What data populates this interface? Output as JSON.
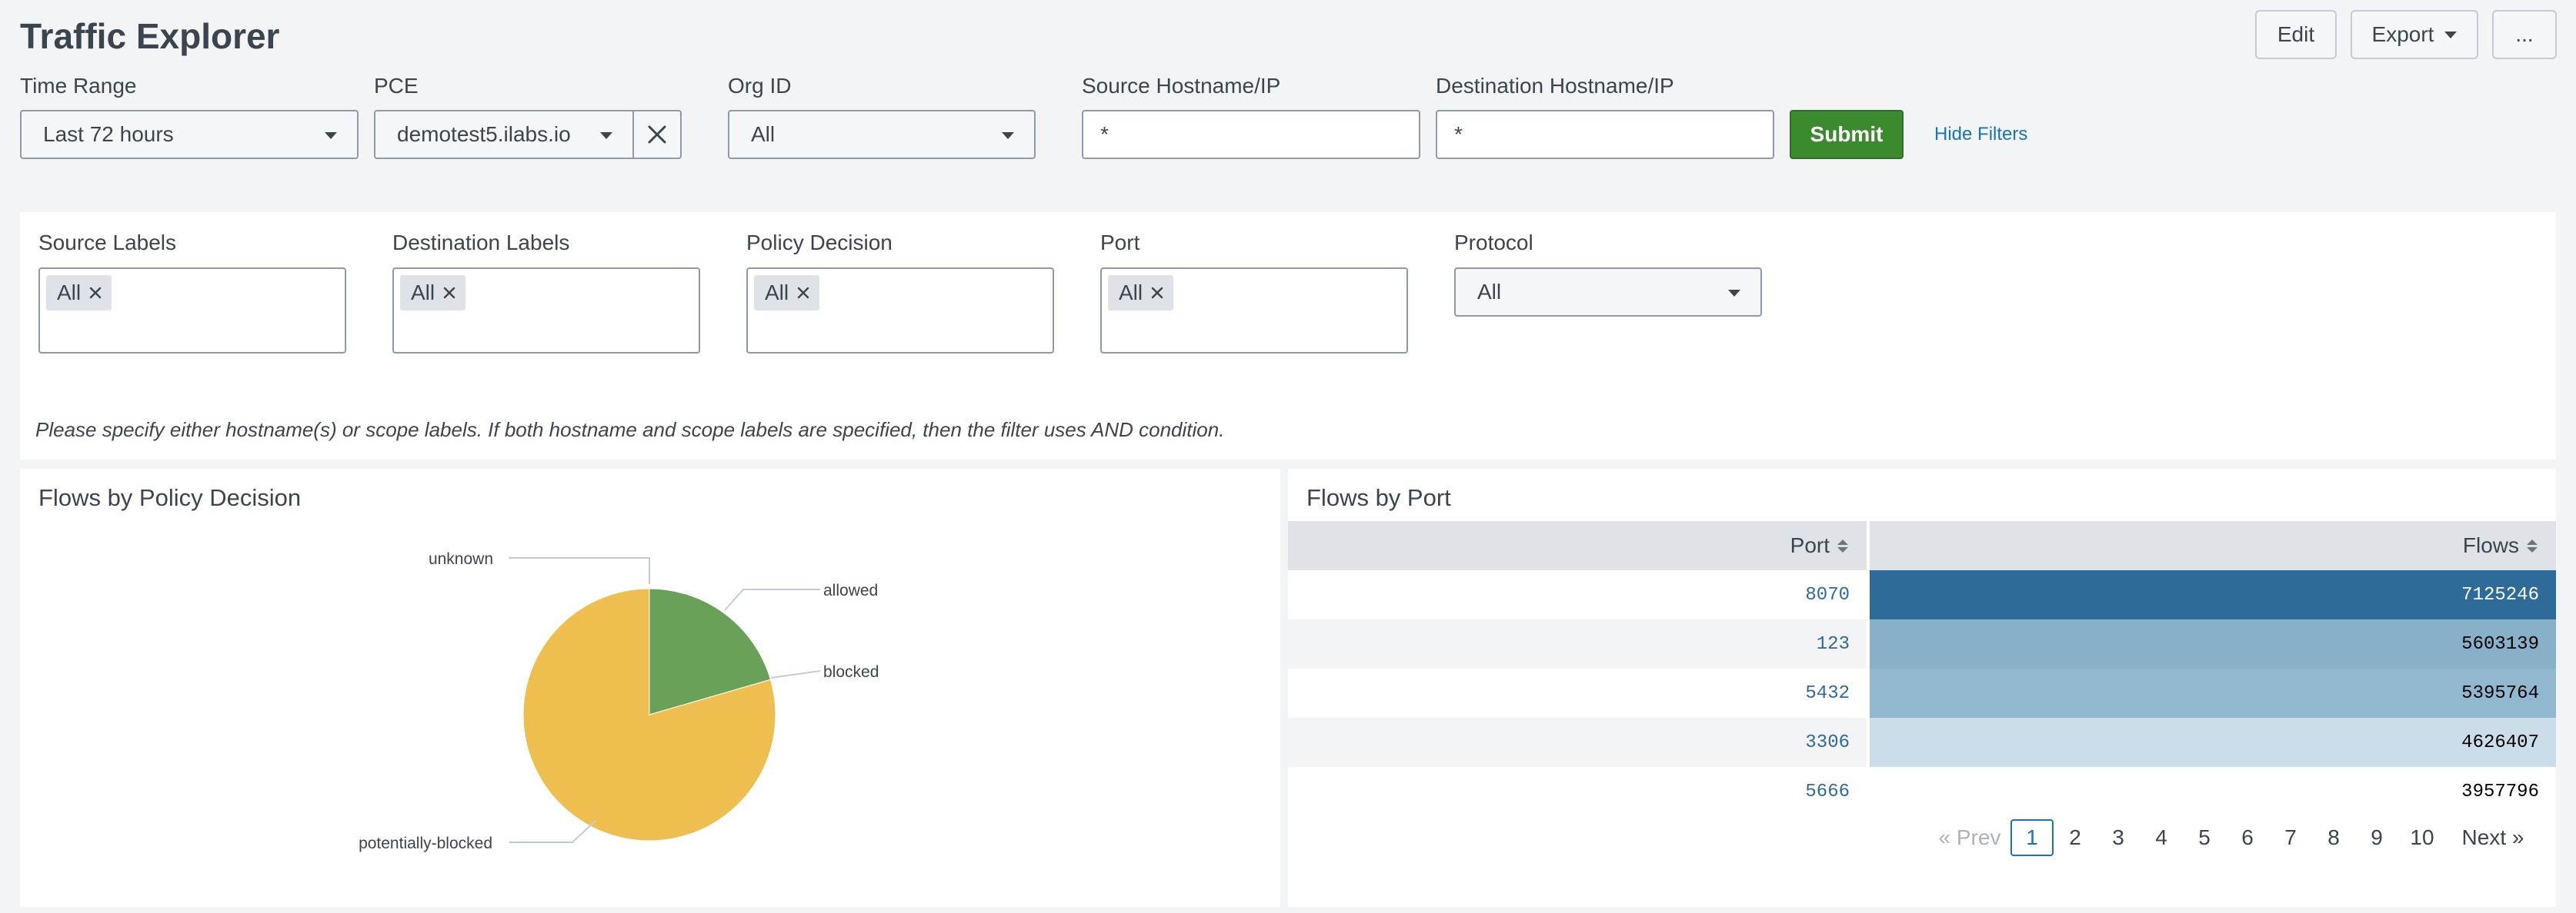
{
  "header": {
    "title": "Traffic Explorer",
    "edit_label": "Edit",
    "export_label": "Export",
    "more_label": "..."
  },
  "filters": {
    "time_range": {
      "label": "Time Range",
      "value": "Last 72 hours"
    },
    "pce": {
      "label": "PCE",
      "value": "demotest5.ilabs.io"
    },
    "org_id": {
      "label": "Org ID",
      "value": "All"
    },
    "source_host": {
      "label": "Source Hostname/IP",
      "value": "*"
    },
    "dest_host": {
      "label": "Destination Hostname/IP",
      "value": "*"
    },
    "submit_label": "Submit",
    "hide_filters_label": "Hide Filters"
  },
  "label_filters": {
    "source_labels": {
      "label": "Source Labels",
      "chip": "All"
    },
    "dest_labels": {
      "label": "Destination Labels",
      "chip": "All"
    },
    "policy_decision": {
      "label": "Policy Decision",
      "chip": "All"
    },
    "port": {
      "label": "Port",
      "chip": "All"
    },
    "protocol": {
      "label": "Protocol",
      "value": "All"
    },
    "note": "Please specify either hostname(s) or scope labels. If both hostname and scope labels are specified, then the filter uses AND condition."
  },
  "policy_panel": {
    "title": "Flows by Policy Decision",
    "chart_data": {
      "type": "pie",
      "slices": [
        {
          "label": "unknown",
          "fraction": 0.0,
          "color": "#6aa159"
        },
        {
          "label": "allowed",
          "fraction": 0.205,
          "color": "#6aa159"
        },
        {
          "label": "blocked",
          "fraction": 0.0,
          "color": "#6aa159"
        },
        {
          "label": "potentially-blocked",
          "fraction": 0.795,
          "color": "#eebf4f"
        }
      ]
    }
  },
  "port_panel": {
    "title": "Flows by Port",
    "columns": [
      "Port",
      "Flows"
    ],
    "rows": [
      {
        "port": "8070",
        "flows": "7125246",
        "bg": "#2e6b99",
        "fg": "#ffffff"
      },
      {
        "port": "123",
        "flows": "5603139",
        "bg": "#88b0c9",
        "fg": "#000000"
      },
      {
        "port": "5432",
        "flows": "5395764",
        "bg": "#92b8cf",
        "fg": "#000000"
      },
      {
        "port": "3306",
        "flows": "4626407",
        "bg": "#cbdde8",
        "fg": "#000000"
      },
      {
        "port": "5666",
        "flows": "3957796",
        "bg": "#ffffff",
        "fg": "#000000"
      }
    ],
    "pagination": {
      "prev": "« Prev",
      "pages": [
        "1",
        "2",
        "3",
        "4",
        "5",
        "6",
        "7",
        "8",
        "9",
        "10"
      ],
      "current": "1",
      "next": "Next »"
    }
  },
  "colors": {
    "link": "#1a73b8",
    "submit": "#3c8a2e",
    "port_text": "#2e6b99"
  }
}
